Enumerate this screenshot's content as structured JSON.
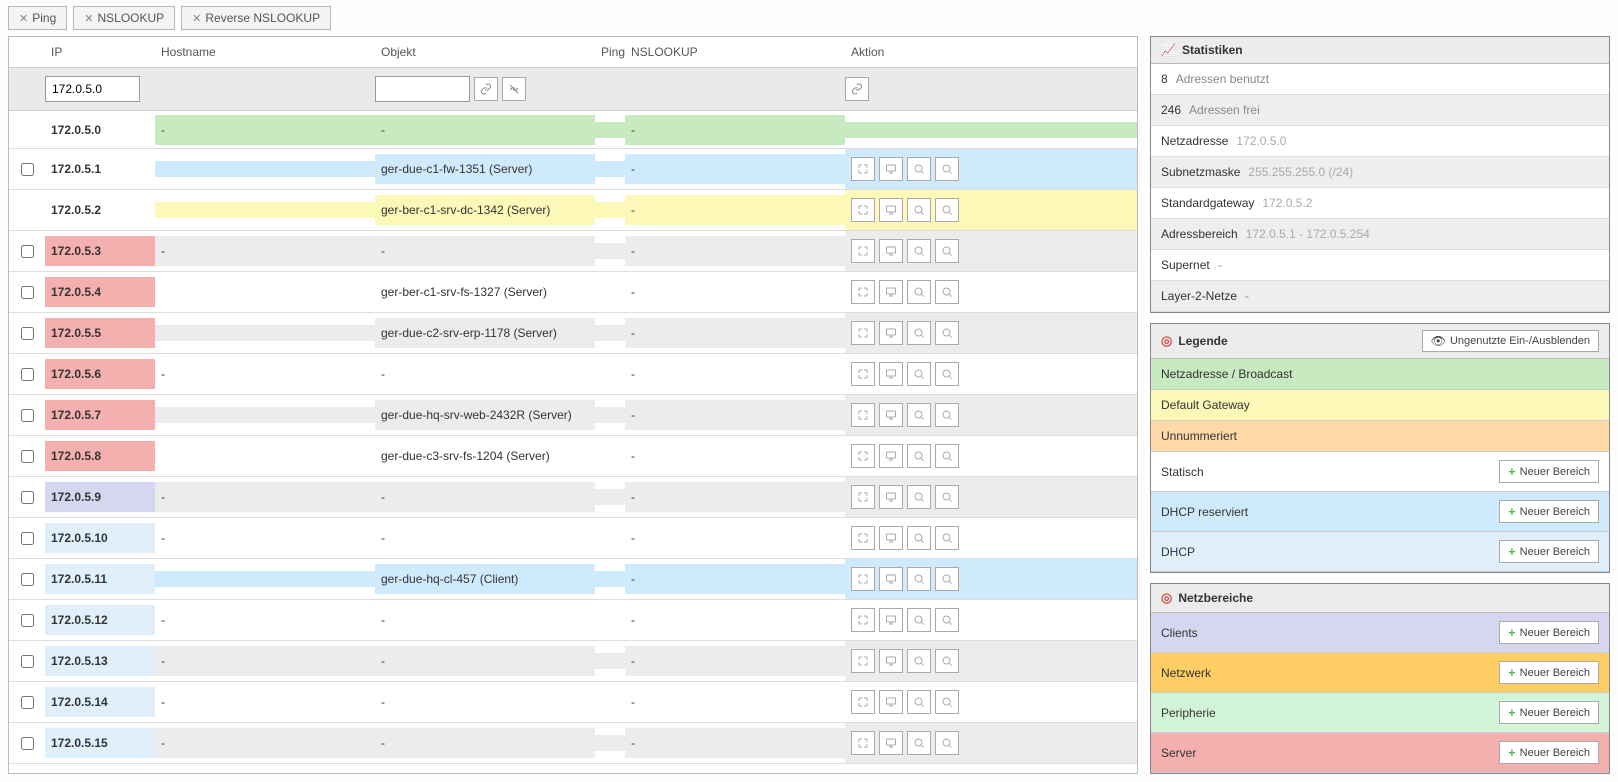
{
  "toolbar": {
    "ping": "Ping",
    "nslookup": "NSLOOKUP",
    "rnslookup": "Reverse NSLOOKUP"
  },
  "table": {
    "headers": {
      "ip": "IP",
      "hostname": "Hostname",
      "objekt": "Objekt",
      "ping": "Ping",
      "nslookup": "NSLOOKUP",
      "aktion": "Aktion"
    },
    "filter": {
      "ip_value": "172.0.5.0",
      "objekt_value": ""
    },
    "rows": [
      {
        "cb": false,
        "ip": "172.0.5.0",
        "ipColor": "",
        "restColor": "c-green",
        "hostname": "-",
        "objekt": "-",
        "ping": "",
        "nsl": "-",
        "actions": false
      },
      {
        "cb": true,
        "ip": "172.0.5.1",
        "ipColor": "",
        "restColor": "c-blue",
        "hostname": "",
        "objekt": "ger-due-c1-fw-1351 (Server)",
        "ping": "",
        "nsl": "-",
        "actions": true
      },
      {
        "cb": false,
        "ip": "172.0.5.2",
        "ipColor": "",
        "restColor": "c-yellow",
        "hostname": "",
        "objekt": "ger-ber-c1-srv-dc-1342 (Server)",
        "ping": "",
        "nsl": "-",
        "actions": true
      },
      {
        "cb": true,
        "ip": "172.0.5.3",
        "ipColor": "c-red",
        "restColor": "c-gray",
        "hostname": "-",
        "objekt": "-",
        "ping": "",
        "nsl": "-",
        "actions": true
      },
      {
        "cb": true,
        "ip": "172.0.5.4",
        "ipColor": "c-red",
        "restColor": "",
        "hostname": "",
        "objekt": "ger-ber-c1-srv-fs-1327 (Server)",
        "ping": "",
        "nsl": "-",
        "actions": true
      },
      {
        "cb": true,
        "ip": "172.0.5.5",
        "ipColor": "c-red",
        "restColor": "c-gray",
        "hostname": "",
        "objekt": "ger-due-c2-srv-erp-1178 (Server)",
        "ping": "",
        "nsl": "-",
        "actions": true
      },
      {
        "cb": true,
        "ip": "172.0.5.6",
        "ipColor": "c-red",
        "restColor": "",
        "hostname": "-",
        "objekt": "-",
        "ping": "",
        "nsl": "-",
        "actions": true
      },
      {
        "cb": true,
        "ip": "172.0.5.7",
        "ipColor": "c-red",
        "restColor": "c-gray",
        "hostname": "",
        "objekt": "ger-due-hq-srv-web-2432R (Server)",
        "ping": "",
        "nsl": "-",
        "actions": true
      },
      {
        "cb": true,
        "ip": "172.0.5.8",
        "ipColor": "c-red",
        "restColor": "",
        "hostname": "",
        "objekt": "ger-due-c3-srv-fs-1204 (Server)",
        "ping": "",
        "nsl": "-",
        "actions": true
      },
      {
        "cb": true,
        "ip": "172.0.5.9",
        "ipColor": "c-lav",
        "restColor": "c-gray",
        "hostname": "-",
        "objekt": "-",
        "ping": "",
        "nsl": "-",
        "actions": true
      },
      {
        "cb": true,
        "ip": "172.0.5.10",
        "ipColor": "c-lblue",
        "restColor": "",
        "hostname": "-",
        "objekt": "-",
        "ping": "",
        "nsl": "-",
        "actions": true
      },
      {
        "cb": true,
        "ip": "172.0.5.11",
        "ipColor": "c-lblue",
        "restColor": "c-blue",
        "hostname": "",
        "objekt": "ger-due-hq-cl-457 (Client)",
        "ping": "",
        "nsl": "-",
        "actions": true
      },
      {
        "cb": true,
        "ip": "172.0.5.12",
        "ipColor": "c-lblue",
        "restColor": "",
        "hostname": "-",
        "objekt": "-",
        "ping": "",
        "nsl": "-",
        "actions": true
      },
      {
        "cb": true,
        "ip": "172.0.5.13",
        "ipColor": "c-lblue",
        "restColor": "c-gray",
        "hostname": "-",
        "objekt": "-",
        "ping": "",
        "nsl": "-",
        "actions": true
      },
      {
        "cb": true,
        "ip": "172.0.5.14",
        "ipColor": "c-lblue",
        "restColor": "",
        "hostname": "-",
        "objekt": "-",
        "ping": "",
        "nsl": "-",
        "actions": true
      },
      {
        "cb": true,
        "ip": "172.0.5.15",
        "ipColor": "c-lblue",
        "restColor": "c-gray",
        "hostname": "-",
        "objekt": "-",
        "ping": "",
        "nsl": "-",
        "actions": true
      }
    ]
  },
  "stats": {
    "title": "Statistiken",
    "rows": [
      {
        "label": "8",
        "value": "Adressen benutzt",
        "alt": false
      },
      {
        "label": "246",
        "value": "Adressen frei",
        "alt": true
      },
      {
        "label": "Netzadresse",
        "value": "172.0.5.0",
        "alt": false,
        "muted": true
      },
      {
        "label": "Subnetzmaske",
        "value": "255.255.255.0 (/24)",
        "alt": true,
        "muted": true
      },
      {
        "label": "Standardgateway",
        "value": "172.0.5.2",
        "alt": false,
        "muted": true
      },
      {
        "label": "Adressbereich",
        "value": "172.0.5.1 - 172.0.5.254",
        "alt": true,
        "muted": true
      },
      {
        "label": "Supernet",
        "value": "-",
        "alt": false
      },
      {
        "label": "Layer-2-Netze",
        "value": "-",
        "alt": true
      }
    ]
  },
  "legend": {
    "title": "Legende",
    "toggle": "Ungenutzte Ein-/Ausblenden",
    "new_range": "Neuer Bereich",
    "rows": [
      {
        "label": "Netzadresse / Broadcast",
        "color": "c-green",
        "btn": false
      },
      {
        "label": "Default Gateway",
        "color": "c-yellow",
        "btn": false
      },
      {
        "label": "Unnummeriert",
        "color": "c-orange",
        "btn": false
      },
      {
        "label": "Statisch",
        "color": "",
        "btn": true
      },
      {
        "label": "DHCP reserviert",
        "color": "c-blue",
        "btn": true
      },
      {
        "label": "DHCP",
        "color": "c-lblue",
        "btn": true
      }
    ]
  },
  "areas": {
    "title": "Netzbereiche",
    "new_range": "Neuer Bereich",
    "rows": [
      {
        "label": "Clients",
        "color": "c-lav"
      },
      {
        "label": "Netzwerk",
        "color": "c-amber"
      },
      {
        "label": "Peripherie",
        "color": "c-mint"
      },
      {
        "label": "Server",
        "color": "c-red"
      }
    ]
  }
}
